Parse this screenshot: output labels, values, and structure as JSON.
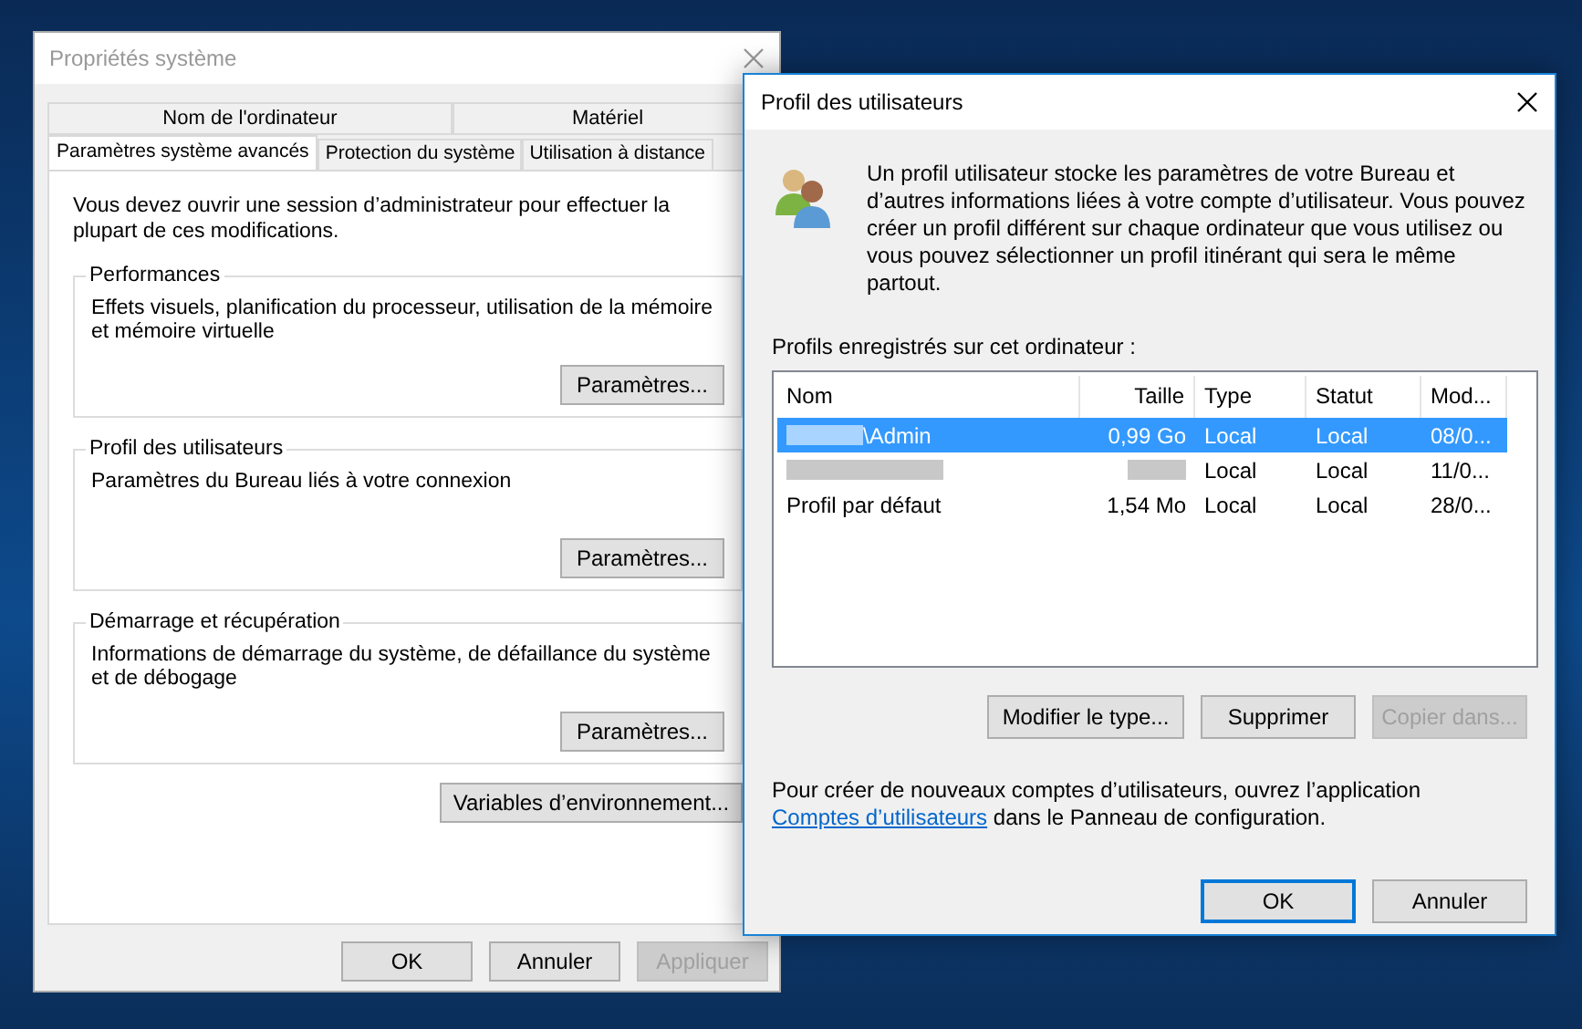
{
  "system_properties": {
    "title": "Propriétés système",
    "active": false,
    "tabs_back": [
      {
        "label": "Nom de l'ordinateur",
        "selected": false
      },
      {
        "label": "Matériel",
        "selected": false
      }
    ],
    "tabs_front": [
      {
        "label": "Paramètres système avancés",
        "selected": true
      },
      {
        "label": "Protection du système",
        "selected": false
      },
      {
        "label": "Utilisation à distance",
        "selected": false
      }
    ],
    "intro": "Vous devez ouvrir une session d’administrateur pour effectuer la plupart de ces modifications.",
    "groups": [
      {
        "title": "Performances",
        "description": "Effets visuels, planification du processeur, utilisation de la mémoire et mémoire virtuelle",
        "button": "Paramètres..."
      },
      {
        "title": "Profil des utilisateurs",
        "description": "Paramètres du Bureau liés à votre connexion",
        "button": "Paramètres..."
      },
      {
        "title": "Démarrage et récupération",
        "description": "Informations de démarrage du système, de défaillance du système et de débogage",
        "button": "Paramètres..."
      }
    ],
    "env_button": "Variables d’environnement...",
    "buttons": [
      {
        "label": "OK",
        "disabled": false
      },
      {
        "label": "Annuler",
        "disabled": false
      },
      {
        "label": "Appliquer",
        "disabled": true
      }
    ]
  },
  "user_profiles": {
    "title": "Profil des utilisateurs",
    "active": true,
    "description": "Un profil utilisateur stocke les paramètres de votre Bureau et d’autres informations liées à votre compte d’utilisateur. Vous pouvez créer un profil différent sur chaque ordinateur que vous utilisez ou vous pouvez sélectionner un profil itinérant qui sera le même partout.",
    "list_label": "Profils enregistrés sur cet ordinateur :",
    "columns": [
      "Nom",
      "Taille",
      "Type",
      "Statut",
      "Mod..."
    ],
    "rows": [
      {
        "name_redacted": true,
        "name": "\\Admin",
        "size": "0,99 Go",
        "size_redacted": false,
        "type": "Local",
        "status": "Local",
        "modified": "08/0...",
        "selected": true
      },
      {
        "name_redacted": true,
        "size_redacted": true,
        "type": "Local",
        "status": "Local",
        "modified": "11/0...",
        "selected": false
      },
      {
        "name_redacted": false,
        "name": "Profil par défaut",
        "size": "1,54 Mo",
        "size_redacted": false,
        "type": "Local",
        "status": "Local",
        "modified": "28/0...",
        "selected": false
      }
    ],
    "buttons": [
      {
        "label": "Modifier le type...",
        "disabled": false
      },
      {
        "label": "Supprimer",
        "disabled": false
      },
      {
        "label": "Copier dans...",
        "disabled": true
      }
    ],
    "footer": {
      "before": "Pour créer de nouveaux comptes d’utilisateurs, ouvrez l’application ",
      "link": "Comptes d’utilisateurs",
      "after": " dans le Panneau de configuration."
    },
    "dialog_buttons": [
      {
        "label": "OK",
        "default": true
      },
      {
        "label": "Annuler",
        "default": false
      }
    ]
  }
}
